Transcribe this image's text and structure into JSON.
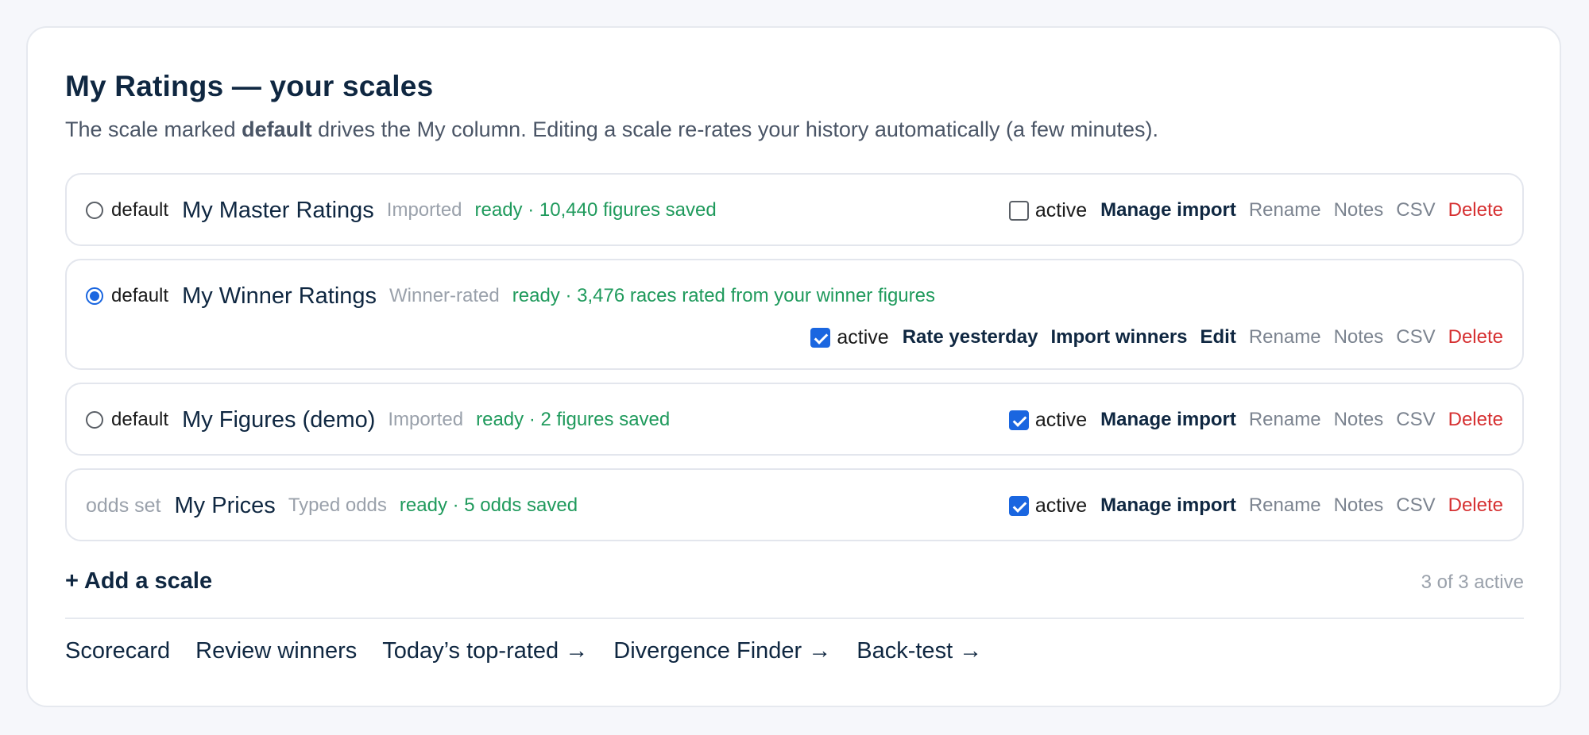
{
  "header": {
    "title": "My Ratings — your scales",
    "subtitle_before": "The scale marked ",
    "subtitle_bold": "default",
    "subtitle_after": " drives the My column. Editing a scale re-rates your history automatically (a few minutes)."
  },
  "scales": [
    {
      "default_label": "default",
      "is_default": false,
      "name": "My Master Ratings",
      "type": "Imported",
      "status": "ready · 10,440 figures saved",
      "active_checked": false,
      "active_label": "active",
      "actions_strong": [
        "Manage import"
      ],
      "rename": "Rename",
      "notes": "Notes",
      "csv": "CSV",
      "delete": "Delete"
    },
    {
      "default_label": "default",
      "is_default": true,
      "name": "My Winner Ratings",
      "type": "Winner-rated",
      "status": "ready · 3,476 races rated from your winner figures",
      "active_checked": true,
      "active_label": "active",
      "actions_strong": [
        "Rate yesterday",
        "Import winners",
        "Edit"
      ],
      "rename": "Rename",
      "notes": "Notes",
      "csv": "CSV",
      "delete": "Delete"
    },
    {
      "default_label": "default",
      "is_default": false,
      "name": "My Figures (demo)",
      "type": "Imported",
      "status": "ready · 2 figures saved",
      "active_checked": true,
      "active_label": "active",
      "actions_strong": [
        "Manage import"
      ],
      "rename": "Rename",
      "notes": "Notes",
      "csv": "CSV",
      "delete": "Delete"
    },
    {
      "kind_label": "odds set",
      "name": "My Prices",
      "type": "Typed odds",
      "status": "ready · 5 odds saved",
      "active_checked": true,
      "active_label": "active",
      "actions_strong": [
        "Manage import"
      ],
      "rename": "Rename",
      "notes": "Notes",
      "csv": "CSV",
      "delete": "Delete"
    }
  ],
  "footer": {
    "add_scale": "+ Add a scale",
    "active_count": "3 of 3 active",
    "links": [
      "Scorecard",
      "Review winners",
      "Today’s top-rated →",
      "Divergence Finder →",
      "Back-test →"
    ]
  },
  "colors": {
    "status_green": "#1f9a5c",
    "delete_red": "#d63031",
    "checkbox_blue": "#1a66e0",
    "heading_navy": "#0f2741"
  }
}
